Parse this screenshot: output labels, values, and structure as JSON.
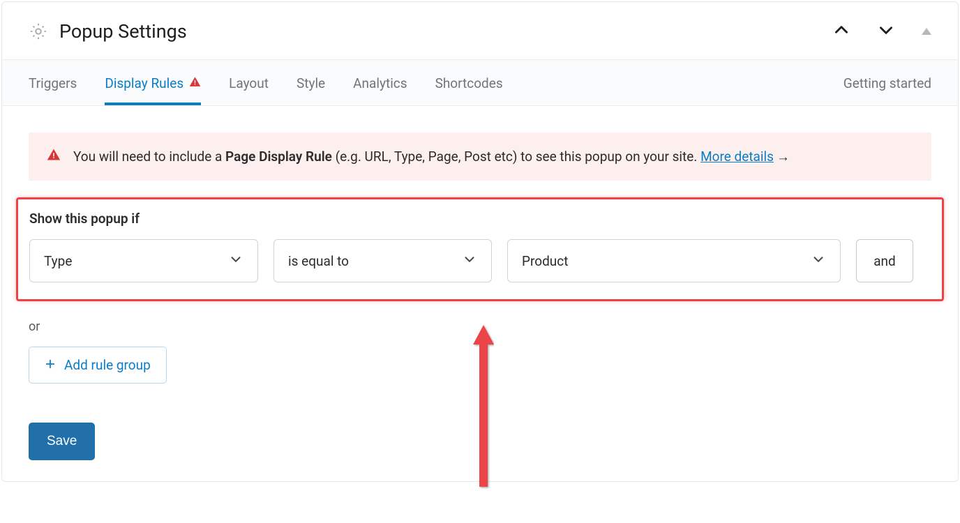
{
  "header": {
    "title": "Popup Settings"
  },
  "tabs": {
    "items": [
      {
        "label": "Triggers"
      },
      {
        "label": "Display Rules"
      },
      {
        "label": "Layout"
      },
      {
        "label": "Style"
      },
      {
        "label": "Analytics"
      },
      {
        "label": "Shortcodes"
      }
    ],
    "right": "Getting started"
  },
  "notice": {
    "prefix": "You will need to include a ",
    "bold": "Page Display Rule",
    "suffix": " (e.g. URL, Type, Page, Post etc) to see this popup on your site. ",
    "link": "More details",
    "arrow": "→"
  },
  "rule": {
    "heading": "Show this popup if",
    "select1": "Type",
    "select2": "is equal to",
    "select3": "Product",
    "and": "and"
  },
  "or_label": "or",
  "add_rule": "Add rule group",
  "save": "Save"
}
